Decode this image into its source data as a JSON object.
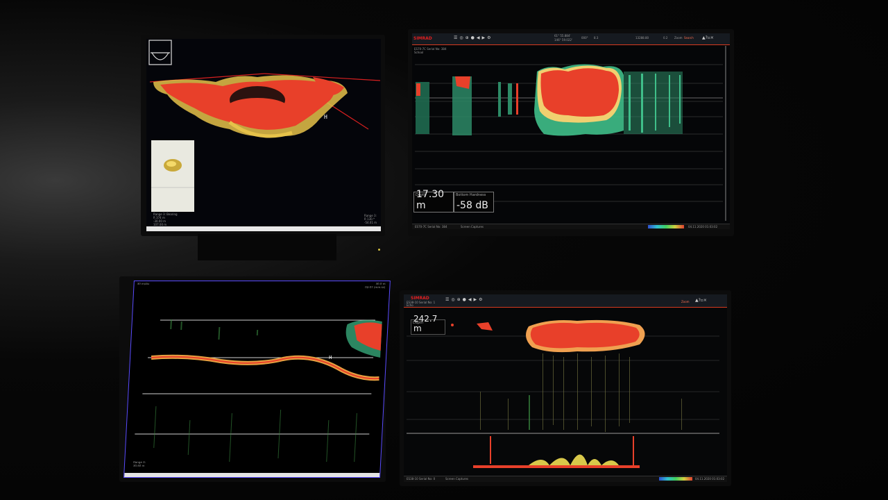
{
  "screens": {
    "top_left": {
      "bottom_left_readout": [
        "Range 3: Bearing",
        "R 374 m",
        "-30.00 m",
        "107.00 m"
      ],
      "bottom_right_readout": [
        "Range 3:",
        "R 130.*",
        "-54.01 m"
      ]
    },
    "top_right": {
      "brand": "SIMRAD",
      "header": [
        "61° 55.884'",
        "146° 59.022'",
        "000°",
        "8.3",
        "13288.80",
        "0.2",
        "Zoom",
        "Search"
      ],
      "transceiver": "ES70-7C Serial No: 384",
      "subheader": "School",
      "depth_readout": {
        "label": "Depth",
        "value": "17.30 m"
      },
      "hardness_readout": {
        "label": "Bottom Hardness",
        "value": "-58 dB"
      },
      "footer_left": "ES70-7C Serial No: 384",
      "footer_tab": "Screen Captures",
      "footer_time": "04.11.2020  01:03:02"
    },
    "bottom_left": {
      "top_left_label": "30 m/div",
      "top_right_labels": [
        "30.0 m",
        "02:07 (mm:ss)"
      ],
      "bottom_left_readout": [
        "Range 3:",
        "30.60 m"
      ]
    },
    "bottom_right": {
      "brand": "SIMRAD",
      "transceiver": "ES38-10 Serial No: 1",
      "subheader": "Echo",
      "depth_readout": {
        "label": "Depth",
        "value": "242.7 m"
      },
      "header": [
        "Zoom"
      ],
      "footer_left": "ES38-10 Serial No: 0",
      "footer_tab": "Screen Captures",
      "footer_time": "04.11.2020  01:03:02"
    }
  },
  "colors": {
    "echo_strong": "#e8402a",
    "echo_mid": "#d8c84a",
    "echo_weak": "#3fbf8a",
    "screen_bg": "#000000",
    "frame_blue": "#5a4cff"
  }
}
